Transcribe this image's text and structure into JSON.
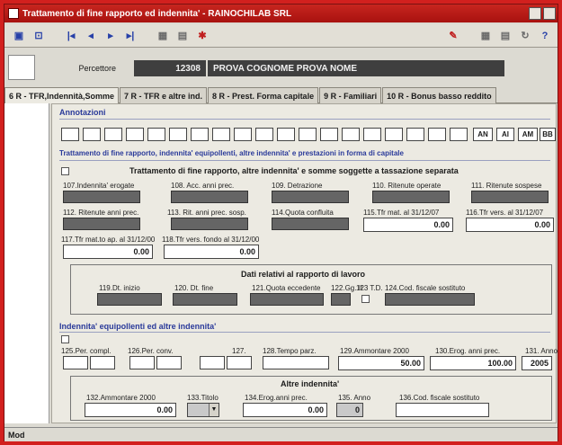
{
  "window": {
    "title": "Trattamento di fine rapporto ed indennita' - RAINOCHILAB SRL"
  },
  "toolbar": {
    "icons": [
      "save-icon",
      "exit-icon",
      "first-record-icon",
      "prev-record-icon",
      "next-record-icon",
      "last-record-icon",
      "print-icon",
      "print-preview-icon",
      "search-icon",
      "tools-icon",
      "table-icon",
      "calc-icon",
      "refresh-icon",
      "help-icon"
    ]
  },
  "header": {
    "percettore_label": "Percettore",
    "code": "12308",
    "name": "PROVA COGNOME PROVA NOME"
  },
  "tabs": [
    "6 R - TFR,Indennità,Somme",
    "7 R - TFR e altre ind.",
    "8 R - Prest. Forma capitale",
    "9 R - Familiari",
    "10 R - Bonus basso reddito"
  ],
  "annotazioni": {
    "label": "Annotazioni",
    "buttons": [
      "AN",
      "AI",
      "AM",
      "BB"
    ]
  },
  "tfr_section": {
    "title": "Trattamento di fine rapporto, indennita' equipollenti, altre indennita' e prestazioni in forma di capitale",
    "subtitle": "Trattamento di fine rapporto, altre indennita' e somme soggette a tassazione separata",
    "f107": "107.Indennita' erogate",
    "f108": "108. Acc. anni prec.",
    "f109": "109. Detrazione",
    "f110": "110. Ritenute operate",
    "f111": "111. Ritenute sospese",
    "f112": "112. Ritenute anni prec.",
    "f113": "113. Rit. anni prec. sosp.",
    "f114": "114.Quota confluita",
    "f115": "115.Tfr mat. al 31/12/07",
    "f115_value": "0.00",
    "f116": "116.Tfr vers. al 31/12/07",
    "f116_value": "0.00",
    "f117": "117.Tfr mat.to ap. al 31/12/00",
    "f117_value": "0.00",
    "f118": "118.Tfr vers. fondo al 31/12/00",
    "f118_value": "0.00"
  },
  "dati_relativi": {
    "title": "Dati relativi al rapporto di lavoro",
    "f119": "119.Dt. inizio",
    "f120": "120. Dt. fine",
    "f121": "121.Quota eccedente",
    "f122": "122.Gg. II",
    "f123": "123 T.D.",
    "f124": "124.Cod. fiscale sostituto"
  },
  "indennita_section": {
    "title": "Indennita' equipollenti ed altre indennita'",
    "f125": "125.Per. compl.",
    "f126": "126.Per. conv.",
    "f127": "127.",
    "f128": "128.Tempo parz.",
    "f129": "129.Ammontare 2000",
    "f129_value": "50.00",
    "f130": "130.Erog. anni prec.",
    "f130_value": "100.00",
    "f131": "131. Anno",
    "f131_value": "2005"
  },
  "altre_indennita": {
    "title": "Altre indennita'",
    "f132": "132.Ammontare 2000",
    "f132_value": "0.00",
    "f133": "133.Titolo",
    "f134": "134.Erog.anni prec.",
    "f134_value": "0.00",
    "f135": "135. Anno",
    "f135_value": "0",
    "f136": "136.Cod. fiscale sostituto"
  },
  "statusbar": {
    "mode": "Mod"
  }
}
